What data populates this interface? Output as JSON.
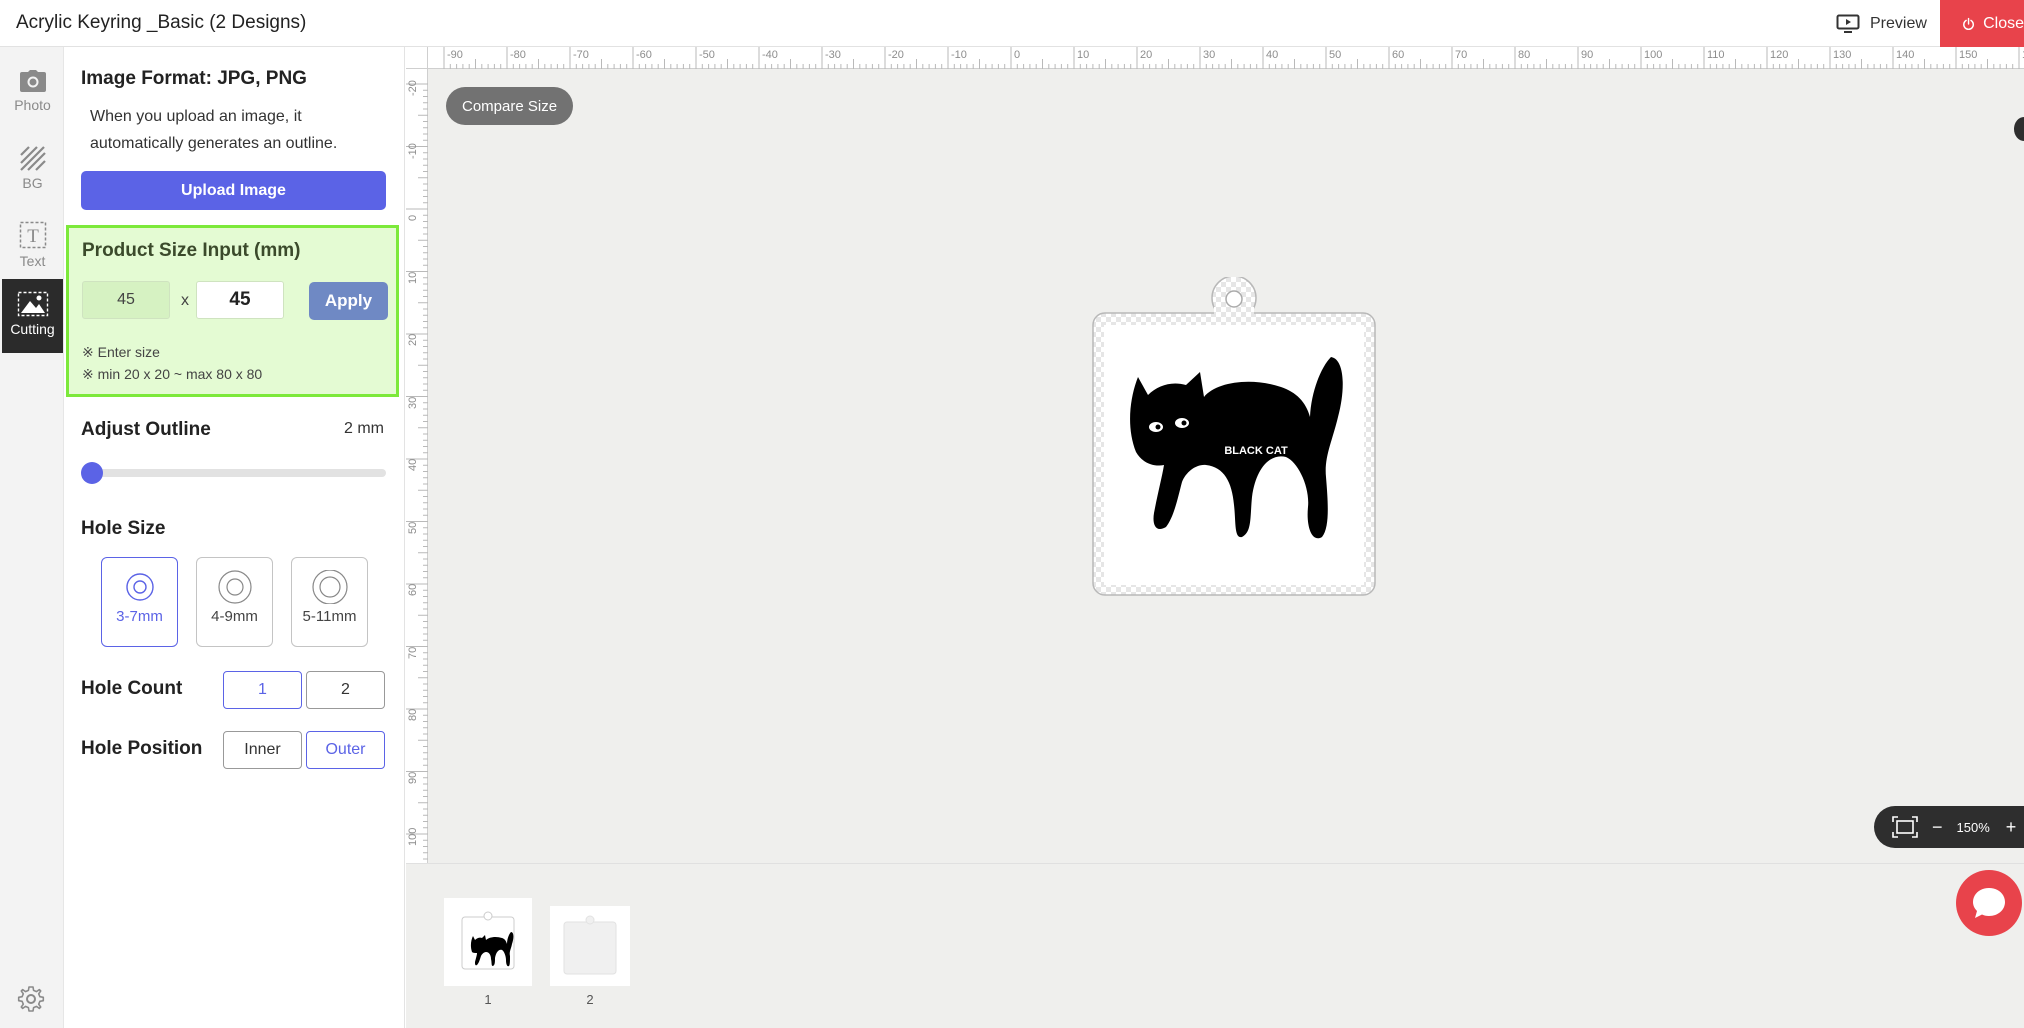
{
  "header": {
    "title": "Acrylic Keyring _Basic (2 Designs)",
    "preview_label": "Preview",
    "close_label": "Close"
  },
  "rail": {
    "items": [
      {
        "label": "Photo",
        "icon": "camera-icon"
      },
      {
        "label": "BG",
        "icon": "hatch-icon"
      },
      {
        "label": "Text",
        "icon": "text-box-icon"
      },
      {
        "label": "Cutting",
        "icon": "landscape-icon",
        "active": true
      }
    ],
    "settings_icon": "gear-icon"
  },
  "panel": {
    "format_title": "Image Format: JPG, PNG",
    "format_desc": "When you upload an image, it automatically generates an outline.",
    "upload_label": "Upload Image",
    "size": {
      "title": "Product Size Input (mm)",
      "width": "45",
      "height": "45",
      "separator": "x",
      "apply_label": "Apply",
      "note1": "※ Enter size",
      "note2": "※ min 20 x 20 ~ max 80 x 80"
    },
    "outline": {
      "title": "Adjust Outline",
      "value": "2 mm",
      "slider_fraction": 0.0
    },
    "hole_size": {
      "title": "Hole Size",
      "options": [
        "3-7mm",
        "4-9mm",
        "5-11mm"
      ],
      "selected": "3-7mm"
    },
    "hole_count": {
      "title": "Hole Count",
      "options": [
        "1",
        "2"
      ],
      "selected": "1"
    },
    "hole_position": {
      "title": "Hole Position",
      "options": [
        "Inner",
        "Outer"
      ],
      "selected": "Outer"
    }
  },
  "workspace": {
    "compare_label": "Compare Size",
    "ruler_top": [
      "-90",
      "-80",
      "-70",
      "-60",
      "-50",
      "-40",
      "-30",
      "-20",
      "-10",
      "0",
      "10",
      "20",
      "30",
      "40",
      "50",
      "60",
      "70",
      "80",
      "90",
      "100",
      "110",
      "120",
      "130",
      "140",
      "150",
      "16"
    ],
    "ruler_left": [
      "-20",
      "-10",
      "0",
      "10",
      "20",
      "30",
      "40",
      "50",
      "60",
      "70",
      "80",
      "90",
      "100"
    ],
    "design_text": "BLACK CAT",
    "zoom": "150%"
  },
  "thumbnails": {
    "items": [
      "1",
      "2"
    ],
    "selected": "1"
  },
  "colors": {
    "accent": "#5b63e6",
    "close_red": "#e8434b",
    "highlight_green": "#7ce93a",
    "highlight_bg": "#e4fbd3"
  }
}
